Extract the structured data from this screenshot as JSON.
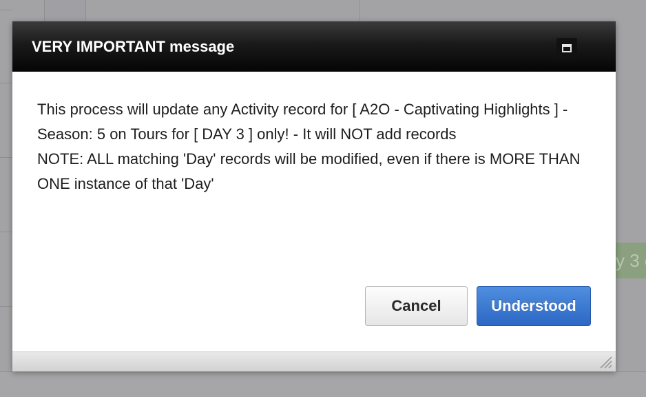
{
  "background": {
    "partial_text": "y 3 c"
  },
  "dialog": {
    "title": "VERY IMPORTANT message",
    "maximize_icon": "maximize-icon",
    "message_line1": "This process will update any Activity record for [ A2O - Captivating Highlights ] - Season: 5 on Tours for [ DAY 3 ] only! - It will NOT add records",
    "message_line2": "NOTE: ALL matching 'Day' records will be modified, even if there is MORE THAN ONE instance of that 'Day'",
    "cancel_label": "Cancel",
    "confirm_label": "Understood",
    "resize_icon": "resize-grip-icon"
  },
  "colors": {
    "titlebar": "#111111",
    "primary_button": "#3a78d2",
    "overlay": "#a3a3a6"
  }
}
